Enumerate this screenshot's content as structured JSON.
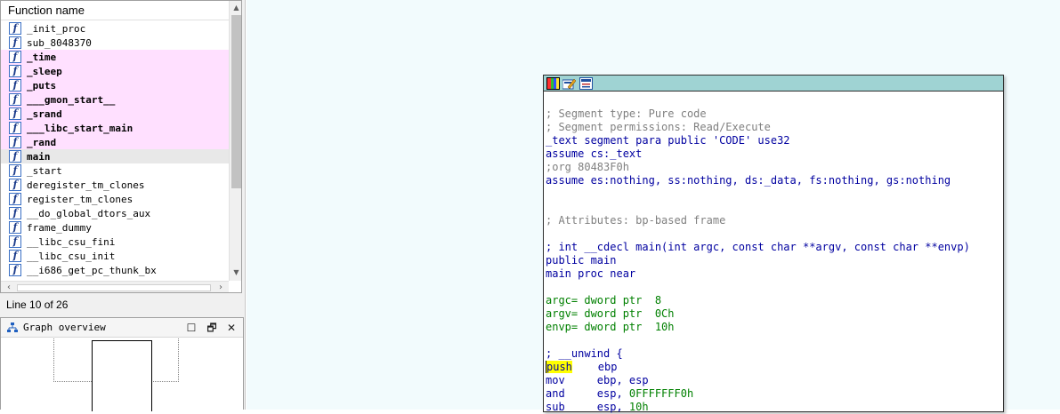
{
  "functions_panel": {
    "header": "Function name",
    "icon_glyph": "f",
    "items": [
      {
        "name": "_init_proc",
        "style": "normal"
      },
      {
        "name": "sub_8048370",
        "style": "normal"
      },
      {
        "name": "_time",
        "style": "lib"
      },
      {
        "name": "_sleep",
        "style": "lib"
      },
      {
        "name": "_puts",
        "style": "lib"
      },
      {
        "name": "___gmon_start__",
        "style": "lib"
      },
      {
        "name": "_srand",
        "style": "lib"
      },
      {
        "name": "___libc_start_main",
        "style": "lib"
      },
      {
        "name": "_rand",
        "style": "lib"
      },
      {
        "name": "main",
        "style": "sel"
      },
      {
        "name": "_start",
        "style": "normal"
      },
      {
        "name": "deregister_tm_clones",
        "style": "normal"
      },
      {
        "name": "register_tm_clones",
        "style": "normal"
      },
      {
        "name": "__do_global_dtors_aux",
        "style": "normal"
      },
      {
        "name": "frame_dummy",
        "style": "normal"
      },
      {
        "name": "__libc_csu_fini",
        "style": "normal"
      },
      {
        "name": "__libc_csu_init",
        "style": "normal"
      },
      {
        "name": "__i686_get_pc_thunk_bx",
        "style": "normal"
      }
    ],
    "status": "Line 10 of 26"
  },
  "graph_overview": {
    "title": "Graph overview",
    "minimize_glyph": "☐",
    "restore_glyph": "🗗",
    "close_glyph": "✕"
  },
  "colors": {
    "lib_row": "#ffe0ff",
    "selected_row": "#e8e8e8",
    "toolbar": "#9fd3d3",
    "comment": "#808080",
    "code": "#0000a0",
    "number": "#008000",
    "highlight": "#ffff00"
  },
  "disassembly": {
    "lines": [
      {
        "segments": [
          {
            "text": "; Segment type: Pure code",
            "cls": "c-gray"
          }
        ]
      },
      {
        "segments": [
          {
            "text": "; Segment permissions: Read/Execute",
            "cls": "c-gray"
          }
        ]
      },
      {
        "segments": [
          {
            "text": "_text segment para public 'CODE' use32",
            "cls": "c-blue"
          }
        ]
      },
      {
        "segments": [
          {
            "text": "assume cs:_text",
            "cls": "c-blue"
          }
        ]
      },
      {
        "segments": [
          {
            "text": ";org 80483F0h",
            "cls": "c-gray"
          }
        ]
      },
      {
        "segments": [
          {
            "text": "assume es:nothing, ss:nothing, ds:_data, fs:nothing, gs:nothing",
            "cls": "c-blue"
          }
        ]
      },
      {
        "segments": []
      },
      {
        "segments": []
      },
      {
        "segments": [
          {
            "text": "; Attributes: bp-based frame",
            "cls": "c-gray"
          }
        ]
      },
      {
        "segments": []
      },
      {
        "segments": [
          {
            "text": "; int __cdecl main(int argc, const char **argv, const char **envp)",
            "cls": "c-blue"
          }
        ]
      },
      {
        "segments": [
          {
            "text": "public main",
            "cls": "c-blue"
          }
        ]
      },
      {
        "segments": [
          {
            "text": "main proc near",
            "cls": "c-blue"
          }
        ]
      },
      {
        "segments": []
      },
      {
        "segments": [
          {
            "text": "argc= dword ptr  ",
            "cls": "c-green"
          },
          {
            "text": "8",
            "cls": "c-green"
          }
        ]
      },
      {
        "segments": [
          {
            "text": "argv= dword ptr  ",
            "cls": "c-green"
          },
          {
            "text": "0Ch",
            "cls": "c-green"
          }
        ]
      },
      {
        "segments": [
          {
            "text": "envp= dword ptr  ",
            "cls": "c-green"
          },
          {
            "text": "10h",
            "cls": "c-green"
          }
        ]
      },
      {
        "segments": []
      },
      {
        "segments": [
          {
            "text": "; __unwind {",
            "cls": "c-blue"
          }
        ]
      },
      {
        "segments": [
          {
            "text": "push",
            "cls": "c-blue hl cursor"
          },
          {
            "text": "    ebp",
            "cls": "c-blue"
          }
        ]
      },
      {
        "segments": [
          {
            "text": "mov     ebp, esp",
            "cls": "c-blue"
          }
        ]
      },
      {
        "segments": [
          {
            "text": "and     esp, ",
            "cls": "c-blue"
          },
          {
            "text": "0FFFFFFF0h",
            "cls": "c-green"
          }
        ]
      },
      {
        "segments": [
          {
            "text": "sub     esp, ",
            "cls": "c-blue"
          },
          {
            "text": "10h",
            "cls": "c-green"
          }
        ]
      }
    ]
  }
}
